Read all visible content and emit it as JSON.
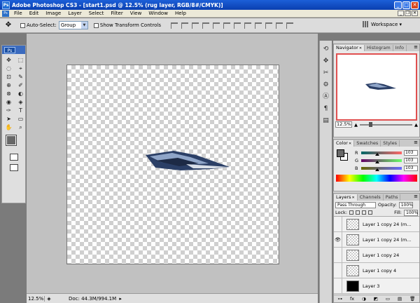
{
  "window": {
    "title": "Adobe Photoshop CS3 - [start1.psd @ 12.5% (rug layer, RGB/8#/CMYK)]",
    "minimize": "_",
    "maximize": "□",
    "close": "✕"
  },
  "menubar": {
    "doc_icon": "Ps",
    "items": [
      "File",
      "Edit",
      "Image",
      "Layer",
      "Select",
      "Filter",
      "View",
      "Window",
      "Help"
    ],
    "mdi_minimize": "_",
    "mdi_restore": "❐",
    "mdi_close": "✕"
  },
  "options": {
    "tool_glyph": "✥",
    "auto_select_label": "Auto-Select:",
    "auto_select_value": "Group",
    "show_transform_label": "Show Transform Controls",
    "workspace_label": "Workspace ▾"
  },
  "toolbox": {
    "logo": "Ps",
    "tools": [
      "✥",
      "⬚",
      "◌",
      "⌖",
      "⊡",
      "✎",
      "⊕",
      "✐",
      "⊗",
      "◐",
      "◉",
      "◈",
      "✑",
      "T",
      "➤",
      "▭",
      "✋",
      "⌕"
    ]
  },
  "statusbar": {
    "zoom": "12.5%",
    "doc": "Doc: 44.3M/994.1M",
    "arrow": "▸"
  },
  "navigator": {
    "tabs": [
      "Navigator",
      "Histogram",
      "Info"
    ],
    "zoom": "12.5%",
    "zoom_out": "▲",
    "zoom_in": "▲",
    "slider_value": 0.32
  },
  "color": {
    "tabs": [
      "Color",
      "Swatches",
      "Styles"
    ],
    "rows": [
      {
        "label": "R",
        "value": "103",
        "level": 0.4,
        "gradient": "linear-gradient(90deg,#006767,#ff6767)"
      },
      {
        "label": "G",
        "value": "103",
        "level": 0.4,
        "gradient": "linear-gradient(90deg,#670067,#67ff67)"
      },
      {
        "label": "B",
        "value": "103",
        "level": 0.4,
        "gradient": "linear-gradient(90deg,#676700,#6767ff)"
      }
    ],
    "fg_color": "#676767"
  },
  "layers": {
    "tabs": [
      "Layers",
      "Channels",
      "Paths"
    ],
    "blend_mode": "Pass Through",
    "opacity_label": "Opacity:",
    "opacity": "100%",
    "lock_label": "Lock:",
    "fill_label": "Fill:",
    "fill": "100%",
    "items": [
      {
        "name": "Layer 1 copy 24 (m...",
        "visible": false,
        "black": false
      },
      {
        "name": "Layer 1 copy 24 (m...",
        "visible": true,
        "black": false
      },
      {
        "name": "Layer 1 copy 24",
        "visible": false,
        "black": false
      },
      {
        "name": "Layer 1 copy 4",
        "visible": false,
        "black": false
      },
      {
        "name": "Layer 3",
        "visible": false,
        "black": true
      }
    ],
    "footer_icons": [
      "⊶",
      "fx",
      "◑",
      "◩",
      "▭",
      "▤",
      "🗑"
    ]
  },
  "dock": {
    "icons": [
      "⟲",
      "✥",
      "✂",
      "⚙",
      "Ⓐ",
      "¶",
      "▤"
    ]
  },
  "colors": {
    "title_bar": "#0a3fb0",
    "artwork_dark": "#2b3f66",
    "artwork_light": "#8fa5c8"
  }
}
